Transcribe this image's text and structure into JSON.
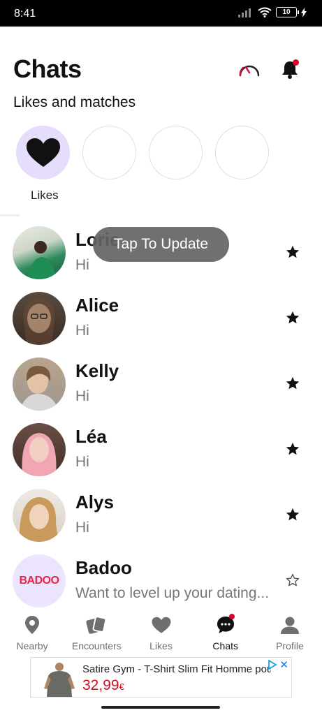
{
  "status_bar": {
    "time": "8:41",
    "battery": "10"
  },
  "header": {
    "title": "Chats",
    "section_title": "Likes and matches"
  },
  "likes": {
    "label": "Likes"
  },
  "toast": {
    "text": "Tap To Update"
  },
  "chats": [
    {
      "name": "Lorie",
      "message": "Hi",
      "starred": true
    },
    {
      "name": "Alice",
      "message": "Hi",
      "starred": true
    },
    {
      "name": "Kelly",
      "message": "Hi",
      "starred": true
    },
    {
      "name": "Léa",
      "message": "Hi",
      "starred": true
    },
    {
      "name": "Alys",
      "message": "Hi",
      "starred": true
    },
    {
      "name": "Badoo",
      "message": "Want to level up your dating...",
      "starred": false,
      "logo_text": "BADOO"
    }
  ],
  "nav": [
    {
      "label": "Nearby",
      "icon": "location-pin-icon"
    },
    {
      "label": "Encounters",
      "icon": "cards-icon"
    },
    {
      "label": "Likes",
      "icon": "heart-icon"
    },
    {
      "label": "Chats",
      "icon": "chat-bubble-icon",
      "active": true
    },
    {
      "label": "Profile",
      "icon": "person-icon"
    }
  ],
  "ad": {
    "title": "Satire Gym - T-Shirt Slim Fit Homme pour",
    "price": "32,99",
    "currency": "€"
  },
  "colors": {
    "accent": "#d4072d",
    "likes_bg": "#e6dcfb",
    "badoo_bg": "#ece4fc",
    "price": "#c7141e"
  }
}
